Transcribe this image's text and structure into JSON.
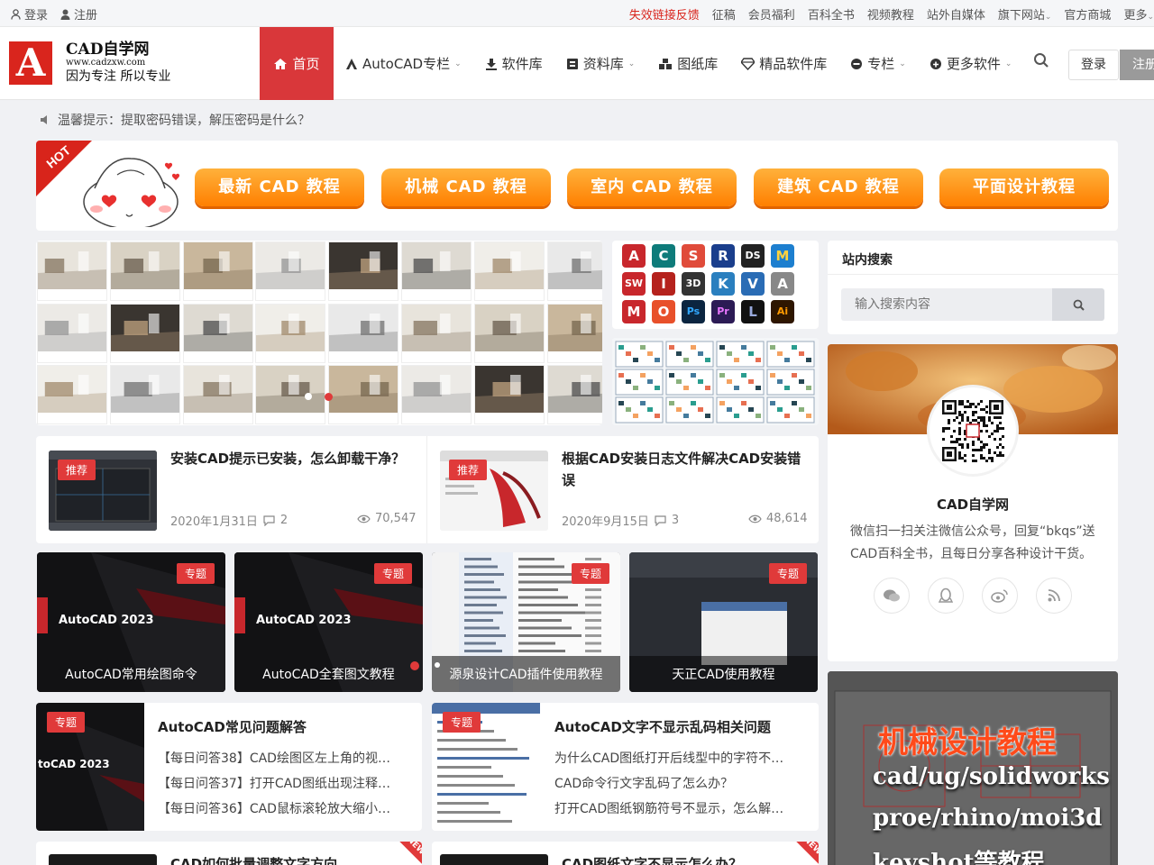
{
  "topbar": {
    "login": "登录",
    "register": "注册",
    "links": [
      {
        "label": "失效链接反馈",
        "color": "#d9251d"
      },
      {
        "label": "征稿"
      },
      {
        "label": "会员福利"
      },
      {
        "label": "百科全书"
      },
      {
        "label": "视频教程"
      },
      {
        "label": "站外自媒体"
      },
      {
        "label": "旗下网站"
      },
      {
        "label": "官方商城"
      },
      {
        "label": "更多"
      }
    ]
  },
  "header": {
    "logo_letter": "A",
    "site_name": "CAD自学网",
    "site_url": "www.cadzxw.com",
    "slogan": "因为专注 所以专业",
    "nav": [
      {
        "label": "首页",
        "icon": "home-icon"
      },
      {
        "label": "AutoCAD专栏",
        "icon": "autocad-icon"
      },
      {
        "label": "软件库",
        "icon": "download-icon"
      },
      {
        "label": "资料库",
        "icon": "book-icon"
      },
      {
        "label": "图纸库",
        "icon": "cubes-icon"
      },
      {
        "label": "精品软件库",
        "icon": "diamond-icon"
      },
      {
        "label": "专栏",
        "icon": "column-icon"
      },
      {
        "label": "更多软件",
        "icon": "cloud-icon"
      }
    ],
    "login": "登录",
    "register": "注册"
  },
  "notice": "温馨提示：提取密码错误，解压密码是什么？",
  "banner": {
    "hot": "HOT",
    "buttons": [
      "最新 CAD 教程",
      "机械 CAD 教程",
      "室内 CAD 教程",
      "建筑 CAD 教程",
      "平面设计教程"
    ]
  },
  "apps": [
    "A",
    "C",
    "S",
    "R",
    "DS",
    "M",
    "SW",
    "I",
    "3D",
    "K",
    "V",
    "A",
    "M",
    "O",
    "Ps",
    "Pr",
    "L",
    "Ai"
  ],
  "posts": [
    {
      "tag": "推荐",
      "title": "安装CAD提示已安装，怎么卸载干净？",
      "date": "2020年1月31日",
      "comments": "2",
      "views": "70,547"
    },
    {
      "tag": "推荐",
      "title": "根据CAD安装日志文件解决CAD安装错误",
      "date": "2020年9月15日",
      "comments": "3",
      "views": "48,614"
    }
  ],
  "topics": [
    {
      "tag": "专题",
      "brand": "AutoCAD 2023",
      "label": "AutoCAD常用绘图命令"
    },
    {
      "tag": "专题",
      "brand": "AutoCAD 2023",
      "label": "AutoCAD全套图文教程"
    },
    {
      "tag": "专题",
      "label": "源泉设计CAD插件使用教程"
    },
    {
      "tag": "专题",
      "label": "天正CAD使用教程"
    }
  ],
  "lists": [
    {
      "tag": "专题",
      "brand": "toCAD 2023",
      "title": "AutoCAD常见问题解答",
      "items": [
        "【每日问答38】CAD绘图区左上角的视…",
        "【每日问答37】打开CAD图纸出现注释…",
        "【每日问答36】CAD鼠标滚轮放大缩小…"
      ]
    },
    {
      "tag": "专题",
      "title": "AutoCAD文字不显示乱码相关问题",
      "items": [
        "为什么CAD图纸打开后线型中的字符不…",
        "CAD命令行文字乱码了怎么办？",
        "打开CAD图纸钢筋符号不显示，怎么解…"
      ]
    }
  ],
  "bottom_posts": [
    {
      "badge": "NEW",
      "title": "CAD如何批量调整文字方向"
    },
    {
      "badge": "NEW",
      "title": "CAD图纸文字不显示怎么办？"
    }
  ],
  "sidebar": {
    "search_title": "站内搜索",
    "search_placeholder": "输入搜索内容",
    "follow_name": "CAD自学网",
    "follow_desc": "微信扫一扫关注微信公众号，回复“bkqs”送CAD百科全书，且每日分享各种设计干货。",
    "socials": [
      "wechat-icon",
      "qq-icon",
      "weibo-icon",
      "rss-icon"
    ],
    "ad_lines": [
      "机械设计教程",
      "cad/ug/solidworks",
      "proe/rhino/moi3d",
      "keyshot等教程"
    ]
  },
  "colors": {
    "accent": "#d9373a",
    "orange": "#ff8c00"
  }
}
